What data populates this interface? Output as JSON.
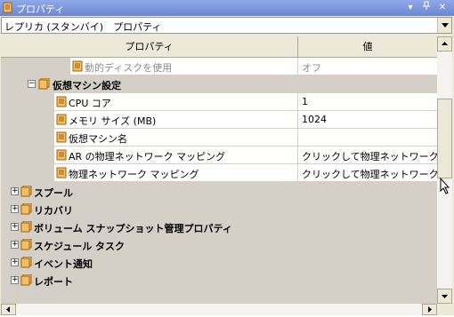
{
  "window": {
    "title": "プロパティ",
    "pin_glyph": "▾",
    "pin2_glyph": "ᛒ",
    "close_glyph": "✕"
  },
  "selector": {
    "value": "レプリカ (スタンバイ)　プロパティ"
  },
  "grid": {
    "columns": [
      "プロパティ",
      "値"
    ],
    "rows": [
      {
        "kind": "prop",
        "label": "動的ディスクを使用",
        "value": "オフ",
        "disabled": true
      },
      {
        "kind": "cat",
        "label": "仮想マシン設定",
        "expanded": true
      },
      {
        "kind": "prop",
        "label": "CPU コア",
        "value": "1"
      },
      {
        "kind": "prop",
        "label": "メモリ サイズ (MB)",
        "value": "1024"
      },
      {
        "kind": "prop",
        "label": "仮想マシン名",
        "value": ""
      },
      {
        "kind": "prop",
        "label": "AR の物理ネットワーク マッピング",
        "value": "クリックして物理ネットワーク マッピ"
      },
      {
        "kind": "prop",
        "label": "物理ネットワーク マッピング",
        "value": "クリックして物理ネットワーク マッピ"
      },
      {
        "kind": "group",
        "label": "スプール",
        "expanded": false
      },
      {
        "kind": "group",
        "label": "リカバリ",
        "expanded": false
      },
      {
        "kind": "group",
        "label": "ボリューム スナップショット管理プロパティ",
        "expanded": false
      },
      {
        "kind": "group",
        "label": "スケジュール タスク",
        "expanded": false
      },
      {
        "kind": "group",
        "label": "イベント通知",
        "expanded": false
      },
      {
        "kind": "group",
        "label": "レポート",
        "expanded": false
      }
    ],
    "expand_glyph": "+",
    "collapse_glyph": "−"
  },
  "colors": {
    "accent": "#6a87d8",
    "icon": "#e8a020"
  }
}
